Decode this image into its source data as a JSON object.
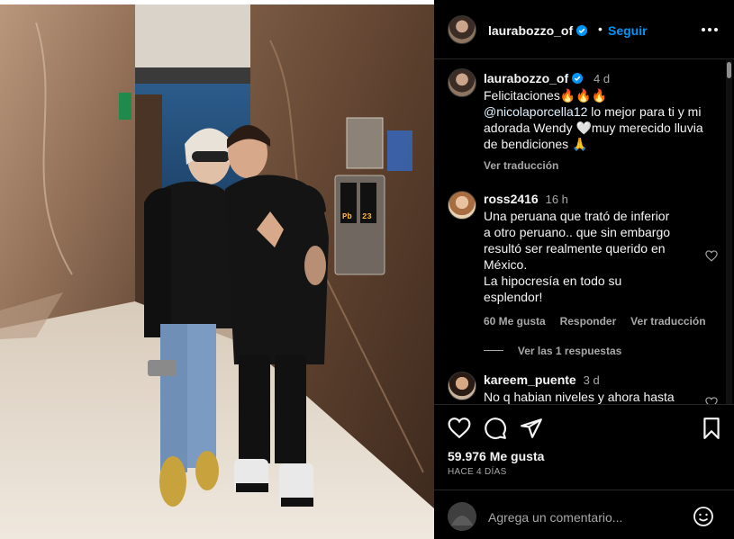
{
  "header": {
    "username": "laurabozzo_of",
    "separator": "•",
    "follow_label": "Seguir"
  },
  "caption": {
    "username": "laurabozzo_of",
    "time": "4 d",
    "line1": "Felicitaciones🔥🔥🔥",
    "mention": "@nicolaporcella12",
    "line2_rest": " lo mejor para ti y mi",
    "line3": "adorada Wendy 🤍muy merecido lluvia",
    "line4": "de bendiciones 🙏",
    "translate": "Ver traducción"
  },
  "comments": [
    {
      "username": "ross2416",
      "time": "16 h",
      "lines": [
        "Una peruana que trató de inferior",
        "a otro peruano.. que sin embargo",
        "resultó ser realmente querido en",
        "México.",
        "La hipocresía en todo su",
        "esplendor!"
      ],
      "likes": "60 Me gusta",
      "reply": "Responder",
      "translate": "Ver traducción",
      "view_replies": "Ver las 1 respuestas"
    },
    {
      "username": "kareem_puente",
      "time": "3 d",
      "lines": [
        "No q habian niveles y ahora hasta"
      ]
    }
  ],
  "actions": {
    "like_count": "59.976 Me gusta",
    "posted": "HACE 4 DÍAS"
  },
  "add_comment": {
    "placeholder": "Agrega un comentario..."
  },
  "photo": {
    "elevator_panel_labels": [
      "Pb",
      "23"
    ]
  },
  "colors": {
    "background": "#000000",
    "accent": "#0095f6",
    "secondary_text": "#a8a8a8",
    "divider": "#262626"
  }
}
